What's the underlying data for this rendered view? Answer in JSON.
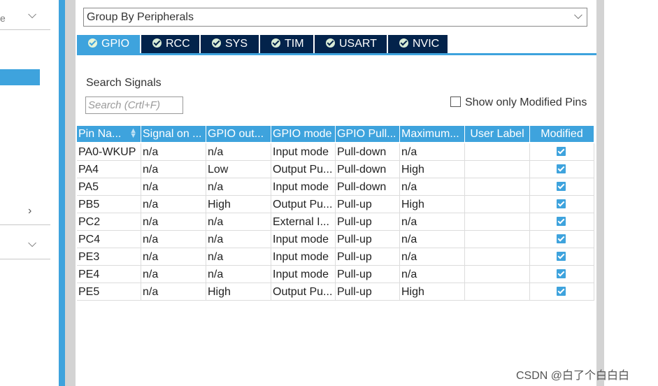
{
  "left_panel": {
    "partial_text": "e"
  },
  "group_by": {
    "value": "Group By Peripherals"
  },
  "tabs": [
    {
      "label": "GPIO",
      "active": true
    },
    {
      "label": "RCC",
      "active": false
    },
    {
      "label": "SYS",
      "active": false
    },
    {
      "label": "TIM",
      "active": false
    },
    {
      "label": "USART",
      "active": false
    },
    {
      "label": "NVIC",
      "active": false
    }
  ],
  "search": {
    "label": "Search Signals",
    "placeholder": "Search (Crtl+F)",
    "value": ""
  },
  "show_modified": {
    "label": "Show only Modified Pins",
    "checked": false
  },
  "table": {
    "columns": [
      "Pin Na...",
      "Signal on ...",
      "GPIO out...",
      "GPIO mode",
      "GPIO Pull...",
      "Maximum...",
      "User Label",
      "Modified"
    ],
    "rows": [
      [
        "PA0-WKUP",
        "n/a",
        "n/a",
        "Input mode",
        "Pull-down",
        "n/a",
        "",
        true
      ],
      [
        "PA4",
        "n/a",
        "Low",
        "Output Pu...",
        "Pull-down",
        "High",
        "",
        true
      ],
      [
        "PA5",
        "n/a",
        "n/a",
        "Input mode",
        "Pull-down",
        "n/a",
        "",
        true
      ],
      [
        "PB5",
        "n/a",
        "High",
        "Output Pu...",
        "Pull-up",
        "High",
        "",
        true
      ],
      [
        "PC2",
        "n/a",
        "n/a",
        "External I...",
        "Pull-up",
        "n/a",
        "",
        true
      ],
      [
        "PC4",
        "n/a",
        "n/a",
        "Input mode",
        "Pull-up",
        "n/a",
        "",
        true
      ],
      [
        "PE3",
        "n/a",
        "n/a",
        "Input mode",
        "Pull-up",
        "n/a",
        "",
        true
      ],
      [
        "PE4",
        "n/a",
        "n/a",
        "Input mode",
        "Pull-up",
        "n/a",
        "",
        true
      ],
      [
        "PE5",
        "n/a",
        "High",
        "Output Pu...",
        "Pull-up",
        "High",
        "",
        true
      ]
    ]
  },
  "watermark": "CSDN @白了个白白白",
  "colors": {
    "accent": "#3ea3dd",
    "tab_dark": "#03234b"
  }
}
